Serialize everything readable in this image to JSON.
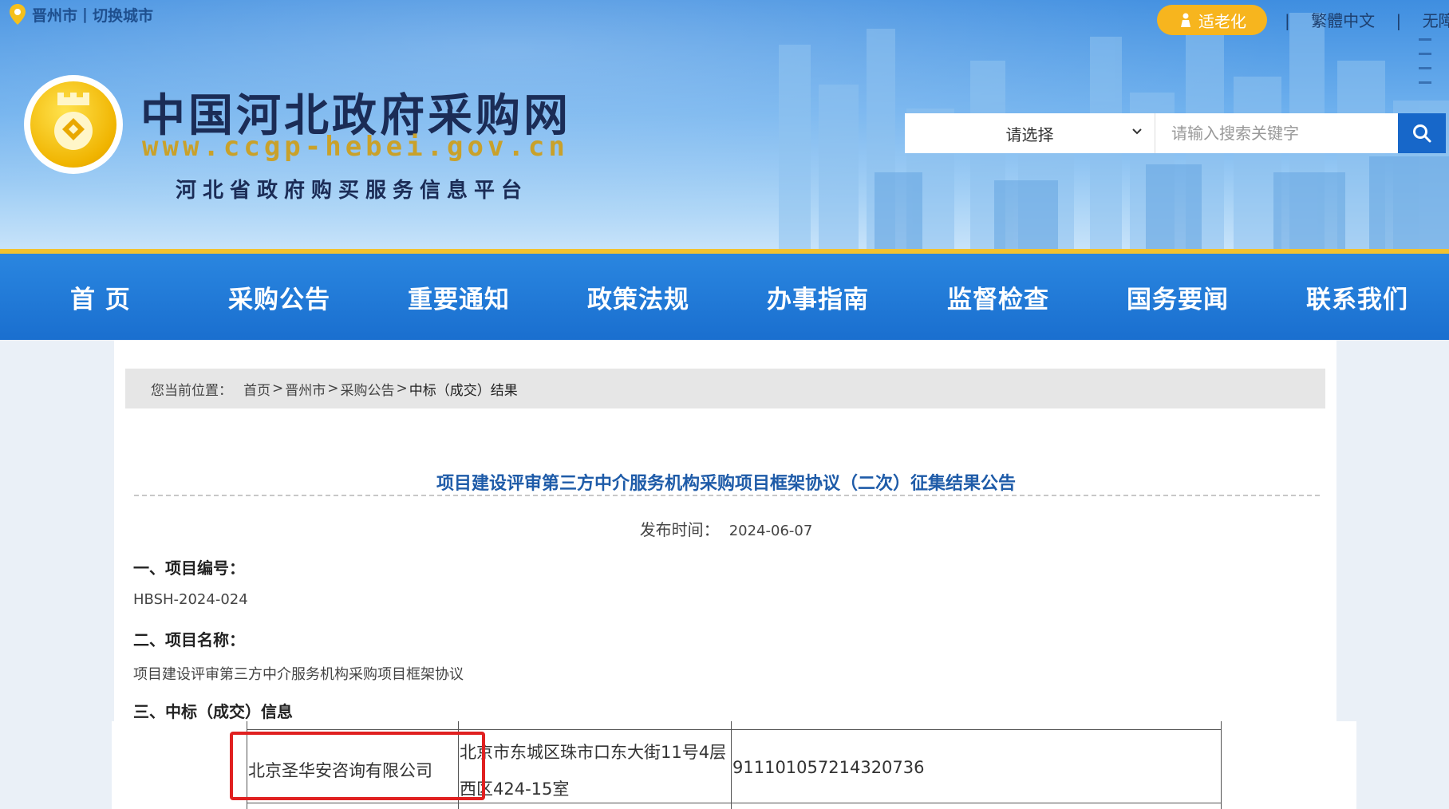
{
  "topbar": {
    "location_city": "晋州市",
    "location_switch": "切换城市",
    "older_mode_label": "适老化",
    "links": [
      "繁體中文",
      "无障碍"
    ]
  },
  "logo": {
    "title": "中国河北政府采购网",
    "url": "www.ccgp-hebei.gov.cn",
    "subtitle": "河北省政府购买服务信息平台"
  },
  "search": {
    "select_value": "请选择",
    "placeholder": "请输入搜索关键字"
  },
  "nav": {
    "items": [
      "首 页",
      "采购公告",
      "重要通知",
      "政策法规",
      "办事指南",
      "监督检查",
      "国务要闻",
      "联系我们"
    ]
  },
  "breadcrumb": {
    "prefix": "您当前位置：",
    "items": [
      "首页",
      "晋州市",
      "采购公告",
      "中标（成交）结果"
    ]
  },
  "article": {
    "title": "项目建设评审第三方中介服务机构采购项目框架协议（二次）征集结果公告",
    "publish_label": "发布时间：",
    "publish_date": "2024-06-07",
    "sections": [
      {
        "heading": "一、项目编号：",
        "value": "HBSH-2024-024"
      },
      {
        "heading": "二、项目名称：",
        "value": "项目建设评审第三方中介服务机构采购项目框架协议"
      },
      {
        "heading": "三、中标（成交）信息",
        "value": ""
      }
    ]
  },
  "result_table": {
    "rows": [
      {
        "company": "北京圣华安咨询有限公司",
        "address_line1": "北京市东城区珠市口东大街11号4层",
        "address_line2": "西区424-15室",
        "credit_code": "911101057214320736"
      }
    ]
  },
  "colors": {
    "nav_bg": "#1a6fcf",
    "accent_gold": "#f2c230",
    "title_blue": "#1e5ba8",
    "highlight_red": "#e02020"
  }
}
